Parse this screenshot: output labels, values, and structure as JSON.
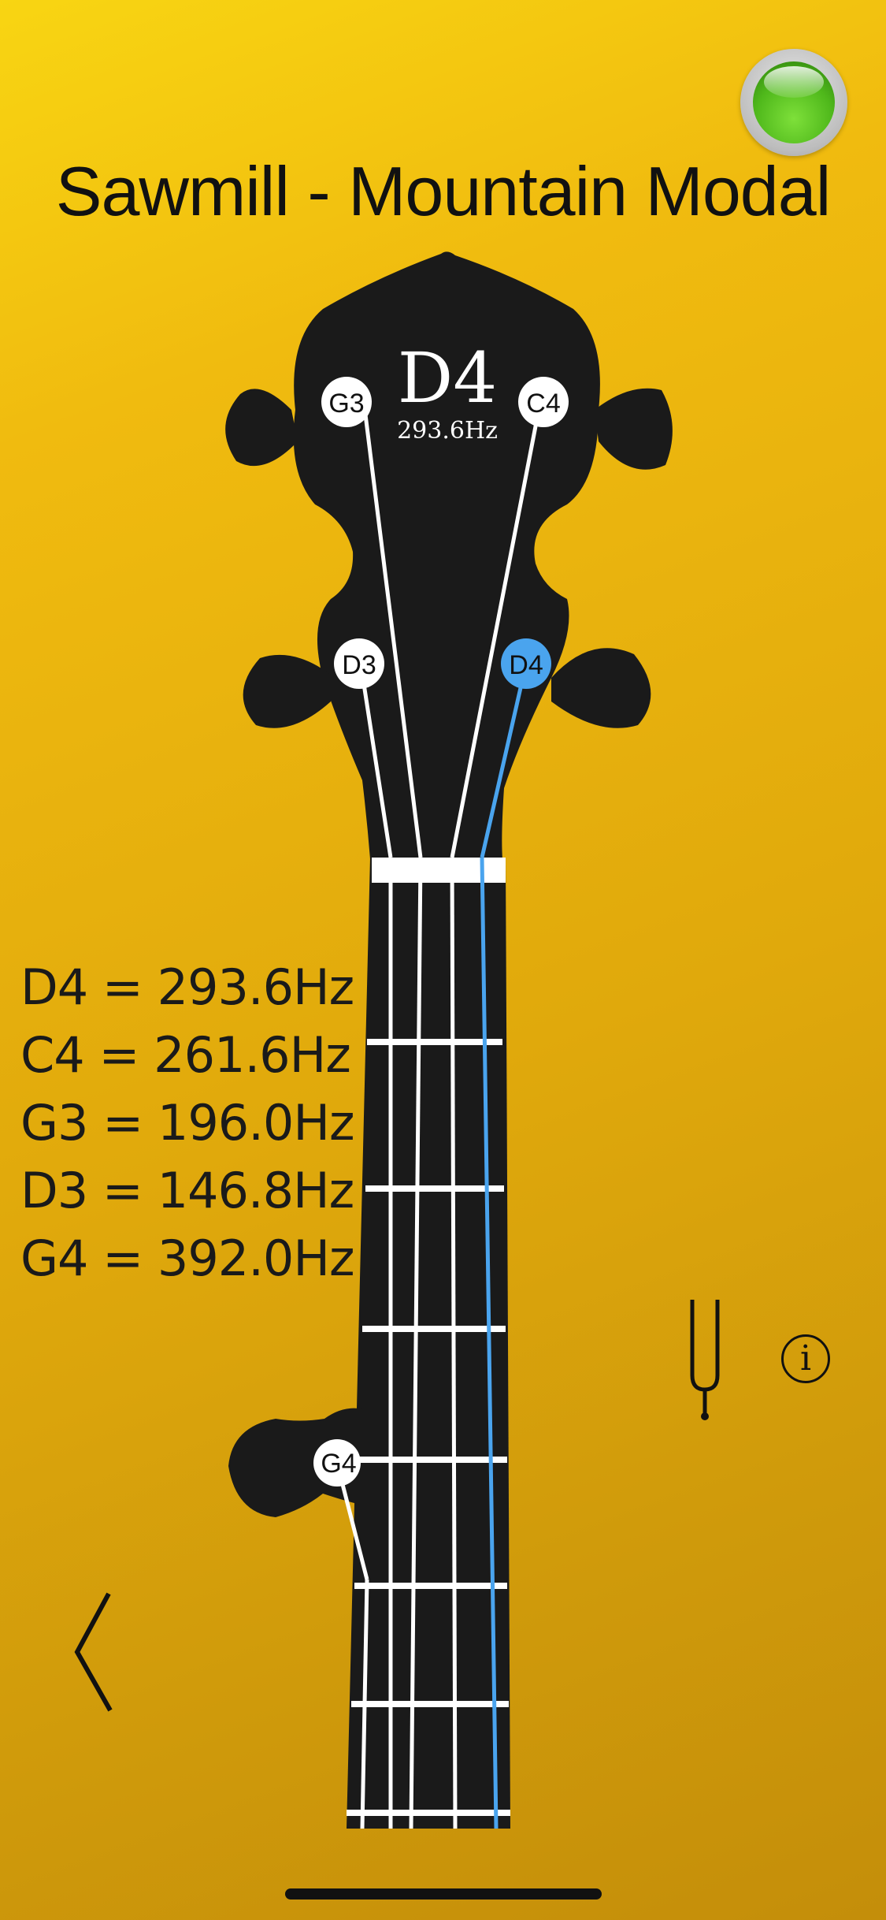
{
  "title": "Sawmill - Mountain Modal",
  "selected_note": {
    "name": "D4",
    "frequency": "293.6Hz"
  },
  "pegs": {
    "g3": "G3",
    "c4": "C4",
    "d3": "D3",
    "d4": "D4",
    "g4": "G4"
  },
  "frequencies": [
    {
      "note": "D4",
      "sep": " = ",
      "value": "293.6Hz"
    },
    {
      "note": "C4",
      "sep": " = ",
      "value": "261.6Hz"
    },
    {
      "note": "G3",
      "sep": " = ",
      "value": "196.0Hz"
    },
    {
      "note": "D3",
      "sep": " = ",
      "value": "146.8Hz"
    },
    {
      "note": "G4",
      "sep": " = ",
      "value": "392.0Hz"
    }
  ],
  "info_label": "i",
  "colors": {
    "active_string": "#4aa4ee",
    "headstock": "#1a1a1a",
    "led": "#4fb81b"
  }
}
